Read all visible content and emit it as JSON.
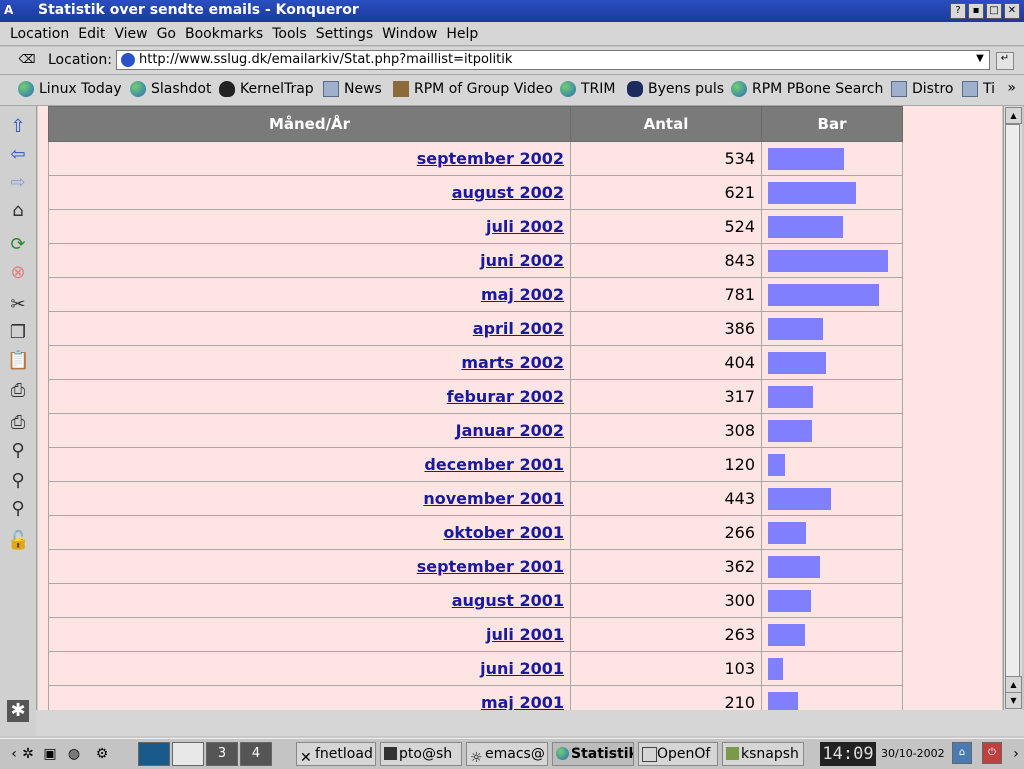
{
  "window": {
    "title": "Statistik over sendte emails - Konqueror"
  },
  "menu": [
    "Location",
    "Edit",
    "View",
    "Go",
    "Bookmarks",
    "Tools",
    "Settings",
    "Window",
    "Help"
  ],
  "location": {
    "label": "Location:",
    "url": "http://www.sslug.dk/emailarkiv/Stat.php?maillist=itpolitik"
  },
  "bookmarks": [
    "Linux Today",
    "Slashdot",
    "KernelTrap",
    "News",
    "RPM of Group Video",
    "TRIM",
    "Byens puls",
    "RPM PBone Search",
    "Distro",
    "Ti"
  ],
  "table": {
    "headers": [
      "Måned/År",
      "Antal",
      "Bar"
    ],
    "rows": [
      {
        "month": "september 2002",
        "count": 534
      },
      {
        "month": "august 2002",
        "count": 621
      },
      {
        "month": "juli 2002",
        "count": 524
      },
      {
        "month": "juni 2002",
        "count": 843
      },
      {
        "month": "maj 2002",
        "count": 781
      },
      {
        "month": "april 2002",
        "count": 386
      },
      {
        "month": "marts 2002",
        "count": 404
      },
      {
        "month": "feburar 2002",
        "count": 317
      },
      {
        "month": "Januar 2002",
        "count": 308
      },
      {
        "month": "december 2001",
        "count": 120
      },
      {
        "month": "november 2001",
        "count": 443
      },
      {
        "month": "oktober 2001",
        "count": 266
      },
      {
        "month": "september 2001",
        "count": 362
      },
      {
        "month": "august 2001",
        "count": 300
      },
      {
        "month": "juli 2001",
        "count": 263
      },
      {
        "month": "juni 2001",
        "count": 103
      },
      {
        "month": "maj 2001",
        "count": 210
      }
    ]
  },
  "taskbar": {
    "desktops": [
      "",
      "",
      "3",
      "4"
    ],
    "tasks": [
      "fnetload",
      "pto@sh",
      "emacs@",
      "Statistik",
      "OpenOf",
      "ksnapsh"
    ],
    "clock": "14:09",
    "date": "30/10-2002"
  },
  "colors": {
    "bar": "#8080ff",
    "content_bg": "#ffe4e4",
    "header_bg": "#7a7a7a",
    "link": "#1a1a9c"
  }
}
